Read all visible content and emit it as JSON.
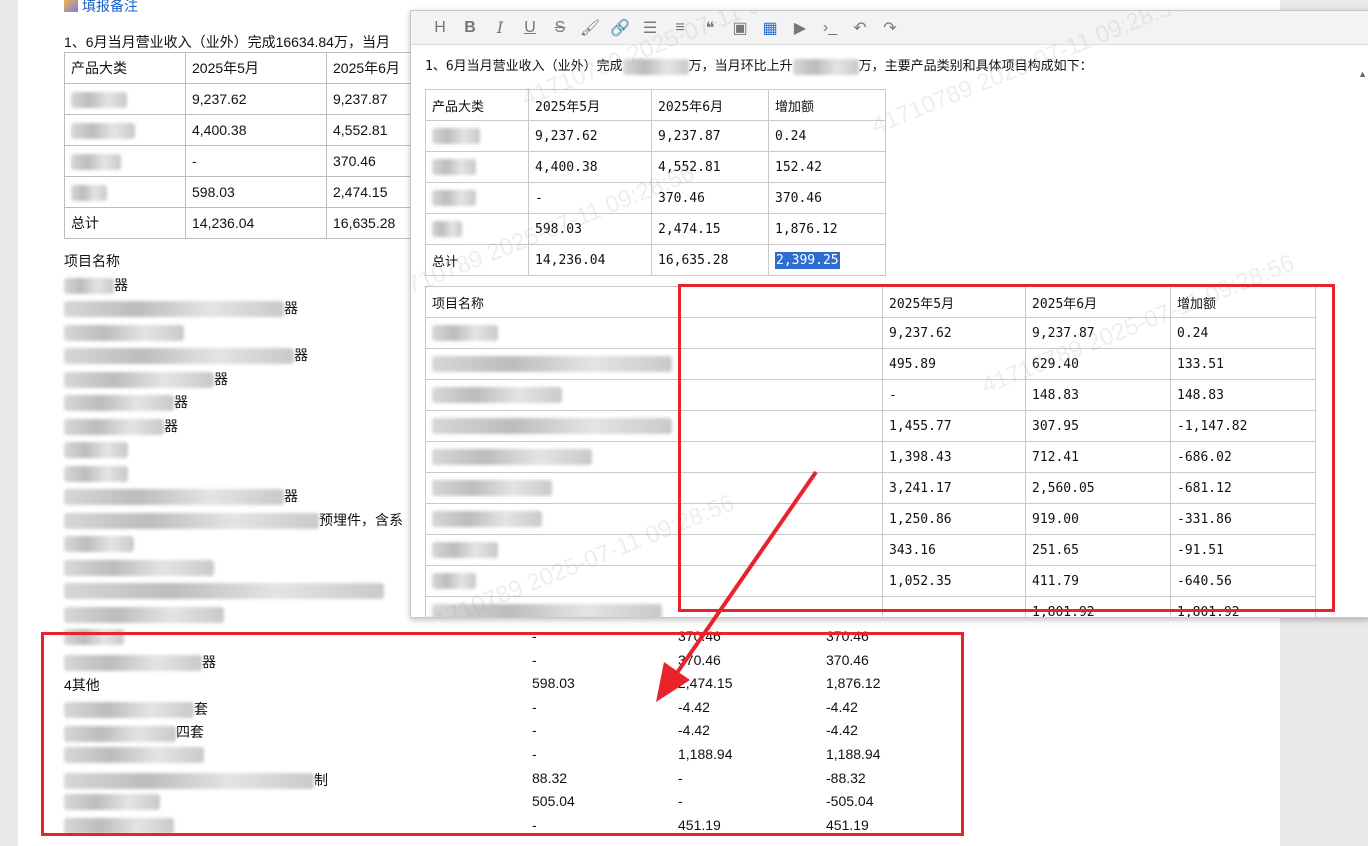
{
  "background_doc": {
    "link_text": "填报备注",
    "intro_text": "1、6月当月营业收入（业外）完成16634.84万，当月",
    "product_table": {
      "headers": [
        "产品大类",
        "2025年5月",
        "2025年6月"
      ],
      "rows": [
        [
          "",
          "9,237.62",
          "9,237.87"
        ],
        [
          "",
          "4,400.38",
          "4,552.81"
        ],
        [
          "",
          "-",
          "370.46"
        ],
        [
          "",
          "598.03",
          "2,474.15"
        ],
        [
          "总计",
          "14,236.04",
          "16,635.28"
        ]
      ]
    },
    "project_list": {
      "header": "项目名称",
      "items": [
        "器",
        "器",
        "器",
        "器",
        "器",
        "器",
        "",
        "",
        "器",
        "预埋件，含系",
        "",
        "",
        ""
      ]
    },
    "bottom_rows": [
      {
        "name": "",
        "may": "-",
        "jun": "370.46",
        "inc": "370.46"
      },
      {
        "name": "器",
        "may": "-",
        "jun": "370.46",
        "inc": "370.46"
      },
      {
        "name": "4其他",
        "may": "598.03",
        "jun": "2,474.15",
        "inc": "1,876.12"
      },
      {
        "name": "套",
        "may": "-",
        "jun": "-4.42",
        "inc": "-4.42"
      },
      {
        "name": "四套",
        "may": "-",
        "jun": "-4.42",
        "inc": "-4.42"
      },
      {
        "name": "",
        "may": "-",
        "jun": "1,188.94",
        "inc": "1,188.94"
      },
      {
        "name": "制",
        "may": "88.32",
        "jun": "-",
        "inc": "-88.32"
      },
      {
        "name": "",
        "may": "505.04",
        "jun": "-",
        "inc": "-505.04"
      },
      {
        "name": "",
        "may": "-",
        "jun": "451.19",
        "inc": "451.19"
      }
    ]
  },
  "editor": {
    "toolbar": [
      {
        "name": "heading",
        "glyph": "H"
      },
      {
        "name": "bold",
        "glyph": "B"
      },
      {
        "name": "italic",
        "glyph": "I"
      },
      {
        "name": "underline",
        "glyph": "U"
      },
      {
        "name": "strikethrough",
        "glyph": "S"
      },
      {
        "name": "brush",
        "glyph": "🖌"
      },
      {
        "name": "link",
        "glyph": "🔗"
      },
      {
        "name": "list",
        "glyph": "☰"
      },
      {
        "name": "align",
        "glyph": "≡"
      },
      {
        "name": "quote",
        "glyph": "❝"
      },
      {
        "name": "image",
        "glyph": "▣"
      },
      {
        "name": "table",
        "glyph": "▦"
      },
      {
        "name": "video",
        "glyph": "▶"
      },
      {
        "name": "code",
        "glyph": "›_"
      },
      {
        "name": "undo",
        "glyph": "↶"
      },
      {
        "name": "redo",
        "glyph": "↷"
      }
    ],
    "paragraph_prefix": "1、6月当月营业收入（业外）完成",
    "paragraph_mid": "万，当月环比上升",
    "paragraph_suffix": "万，主要产品类别和具体项目构成如下：",
    "category_table": {
      "headers": [
        "产品大类",
        "2025年5月",
        "2025年6月",
        "增加额"
      ],
      "rows": [
        [
          "",
          "9,237.62",
          "9,237.87",
          "0.24"
        ],
        [
          "",
          "4,400.38",
          "4,552.81",
          "152.42"
        ],
        [
          "",
          "-",
          "370.46",
          "370.46"
        ],
        [
          "",
          "598.03",
          "2,474.15",
          "1,876.12"
        ],
        [
          "总计",
          "14,236.04",
          "16,635.28",
          "2,399.25"
        ]
      ]
    },
    "project_table": {
      "headers": [
        "项目名称",
        "2025年5月",
        "2025年6月",
        "增加额"
      ],
      "rows": [
        [
          "",
          "9,237.62",
          "9,237.87",
          "0.24"
        ],
        [
          "",
          "495.89",
          "629.40",
          "133.51"
        ],
        [
          "",
          "-",
          "148.83",
          "148.83"
        ],
        [
          "",
          "1,455.77",
          "307.95",
          "-1,147.82"
        ],
        [
          "",
          "1,398.43",
          "712.41",
          "-686.02"
        ],
        [
          "",
          "3,241.17",
          "2,560.05",
          "-681.12"
        ],
        [
          "",
          "1,250.86",
          "919.00",
          "-331.86"
        ],
        [
          "",
          "343.16",
          "251.65",
          "-91.51"
        ],
        [
          "",
          "1,052.35",
          "411.79",
          "-640.56"
        ],
        [
          "",
          "",
          "1,801.92",
          "1,801.92"
        ]
      ]
    },
    "watermarks": [
      "41710789 2025-07-11 09:28:56"
    ]
  },
  "annotation_color": "#e8232b"
}
